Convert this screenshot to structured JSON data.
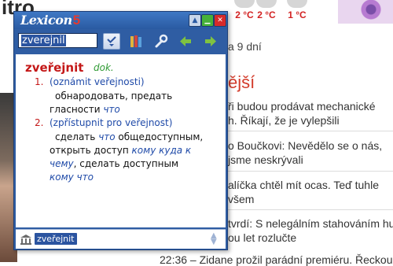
{
  "background_page": {
    "title_fragment": "itro",
    "weather": [
      {
        "temp": "2 °C"
      },
      {
        "temp": "2 °C"
      },
      {
        "temp": "1 °C"
      }
    ],
    "date_fragment": "a 9 dní",
    "heading_fragment": "ější",
    "lines": [
      "ři budou prodávat mechanické",
      "h. Říkají, že je vylepšili",
      "o Boučkovi: Nevědělo se o nás,",
      "jsme neskrývali",
      "alíčka chtěl mít ocas. Teď tuhle",
      "všem",
      "tvrdí: S nelegálním stahováním hu",
      "ou let rozlučte",
      "22:36 – Zidane prožil parádní premiéru. Řeckou"
    ]
  },
  "lexicon": {
    "logo": "Lexicon",
    "logo_version": "5",
    "window_buttons": {
      "up": "▲",
      "minimize": "▁",
      "close": "✕"
    },
    "search": {
      "value": "zverejnil"
    },
    "entry": {
      "headword": "zveřejnit",
      "pos": "dok.",
      "senses": [
        {
          "number": "1.",
          "gloss": "(oznámit veřejnosti)",
          "translation_lines": [
            [
              "обнародовать, предать",
              ""
            ],
            [
              "гласности ",
              "что"
            ]
          ]
        },
        {
          "number": "2.",
          "gloss": "(zpřístupnit pro veřejnost)",
          "translation_lines": [
            [
              "сделать ",
              "что",
              " общедоступным,"
            ],
            [
              "открыть доступ ",
              "кому куда к"
            ],
            [
              "",
              "чему",
              ", сделать доступным"
            ],
            [
              "",
              "кому что"
            ]
          ]
        }
      ]
    },
    "status": {
      "tag": "zveřejnit"
    }
  }
}
